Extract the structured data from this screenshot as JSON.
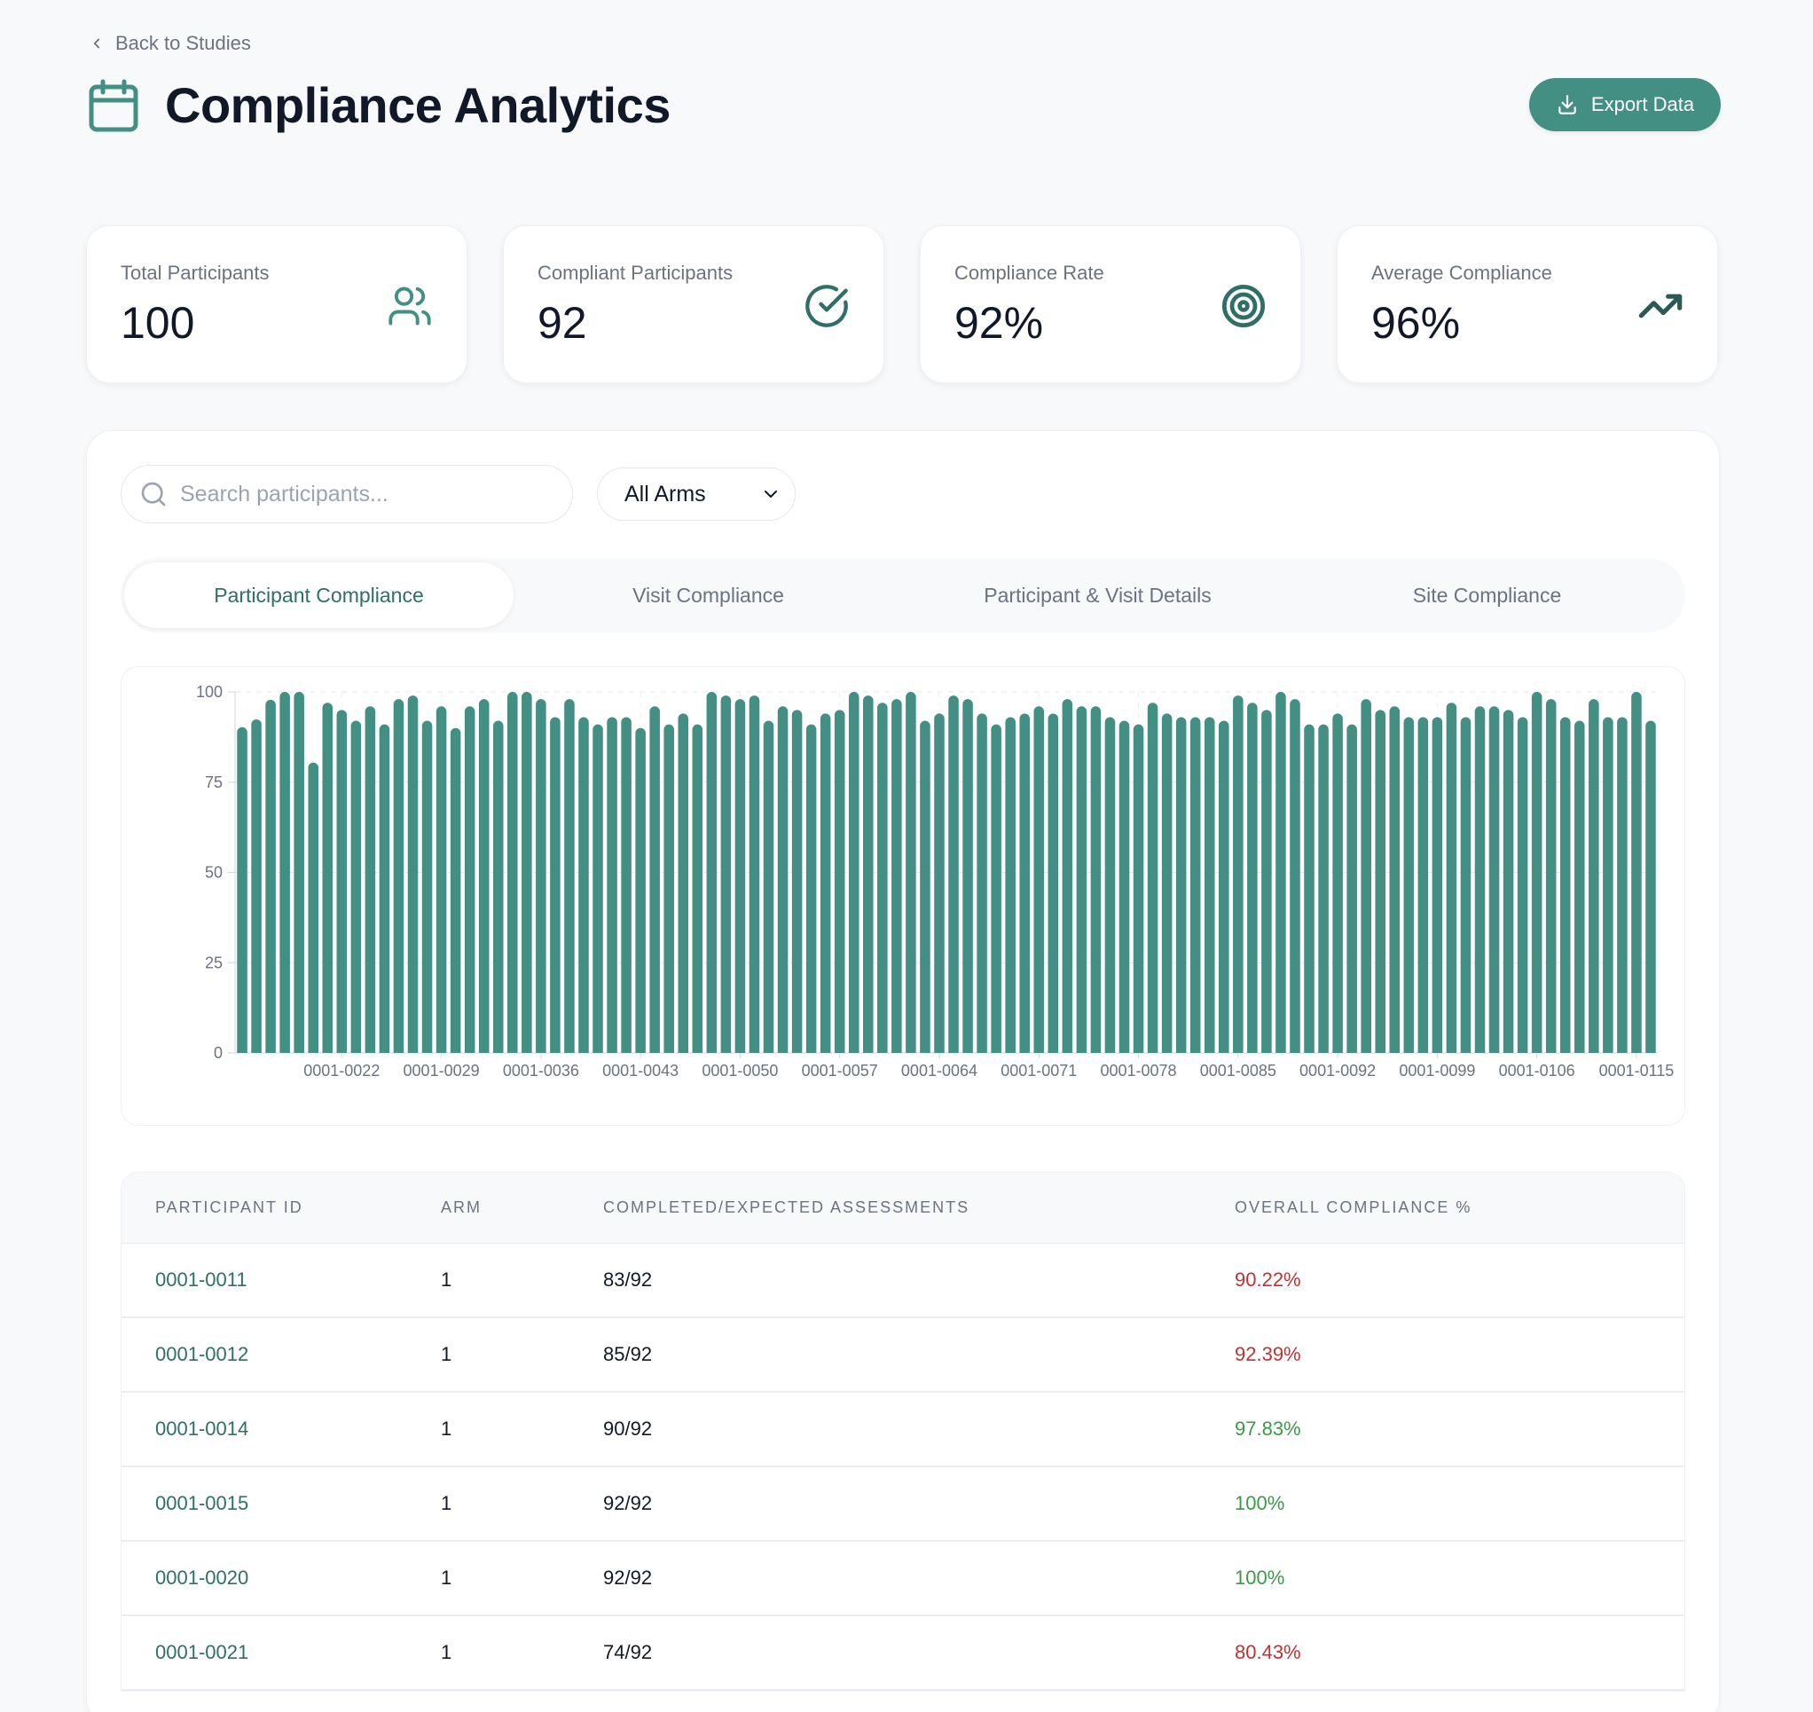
{
  "nav": {
    "back_label": "Back to Studies"
  },
  "header": {
    "title": "Compliance Analytics",
    "export_label": "Export Data"
  },
  "colors": {
    "accent": "#438f84",
    "accent_dark": "#2f6f66",
    "low": "#c53030",
    "high": "#3a9a48",
    "bar": "#438f84"
  },
  "stats": [
    {
      "label": "Total Participants",
      "value": "100",
      "icon": "users-icon"
    },
    {
      "label": "Compliant Participants",
      "value": "92",
      "icon": "check-circle-icon"
    },
    {
      "label": "Compliance Rate",
      "value": "92%",
      "icon": "target-icon"
    },
    {
      "label": "Average Compliance",
      "value": "96%",
      "icon": "trending-up-icon"
    }
  ],
  "filters": {
    "search_placeholder": "Search participants...",
    "search_value": "",
    "arm_selected": "All Arms"
  },
  "tabs": [
    {
      "label": "Participant Compliance",
      "active": true
    },
    {
      "label": "Visit Compliance",
      "active": false
    },
    {
      "label": "Participant & Visit Details",
      "active": false
    },
    {
      "label": "Site Compliance",
      "active": false
    }
  ],
  "chart_data": {
    "type": "bar",
    "title": "",
    "xlabel": "",
    "ylabel": "",
    "ylim": [
      0,
      100
    ],
    "yticks": [
      0,
      25,
      50,
      75,
      100
    ],
    "grid": true,
    "legend": "none",
    "xtick_labels": [
      "0001-0022",
      "0001-0029",
      "0001-0036",
      "0001-0043",
      "0001-0050",
      "0001-0057",
      "0001-0064",
      "0001-0071",
      "0001-0078",
      "0001-0085",
      "0001-0092",
      "0001-0099",
      "0001-0106",
      "0001-0115"
    ],
    "xtick_indices": [
      7,
      14,
      21,
      28,
      35,
      42,
      49,
      56,
      63,
      70,
      77,
      84,
      91,
      98
    ],
    "series": [
      {
        "name": "Overall Compliance %",
        "values": [
          90.22,
          92.39,
          97.83,
          100,
          100,
          80.43,
          97,
          95,
          92,
          96,
          91,
          98,
          99,
          92,
          96,
          90,
          96,
          98,
          92,
          100,
          100,
          98,
          93,
          98,
          93,
          91,
          93,
          93,
          90,
          96,
          91,
          94,
          91,
          100,
          99,
          98,
          99,
          92,
          96,
          95,
          91,
          94,
          95,
          100,
          99,
          97,
          98,
          100,
          92,
          94,
          99,
          98,
          94,
          91,
          93,
          94,
          96,
          94,
          98,
          96,
          96,
          93,
          92,
          91,
          97,
          94,
          93,
          93,
          93,
          92,
          99,
          97,
          95,
          100,
          98,
          91,
          91,
          94,
          91,
          98,
          95,
          96,
          93,
          93,
          93,
          97,
          93,
          96,
          96,
          95,
          93,
          100,
          98,
          93,
          92,
          98,
          93,
          93,
          100,
          92
        ]
      }
    ]
  },
  "table": {
    "columns": [
      "Participant ID",
      "Arm",
      "Completed/Expected Assessments",
      "Overall Compliance %"
    ],
    "rows": [
      {
        "id": "0001-0011",
        "arm": "1",
        "ratio": "83/92",
        "pct": "90.22%",
        "status": "low"
      },
      {
        "id": "0001-0012",
        "arm": "1",
        "ratio": "85/92",
        "pct": "92.39%",
        "status": "low"
      },
      {
        "id": "0001-0014",
        "arm": "1",
        "ratio": "90/92",
        "pct": "97.83%",
        "status": "high"
      },
      {
        "id": "0001-0015",
        "arm": "1",
        "ratio": "92/92",
        "pct": "100%",
        "status": "high"
      },
      {
        "id": "0001-0020",
        "arm": "1",
        "ratio": "92/92",
        "pct": "100%",
        "status": "high"
      },
      {
        "id": "0001-0021",
        "arm": "1",
        "ratio": "74/92",
        "pct": "80.43%",
        "status": "low"
      }
    ]
  }
}
